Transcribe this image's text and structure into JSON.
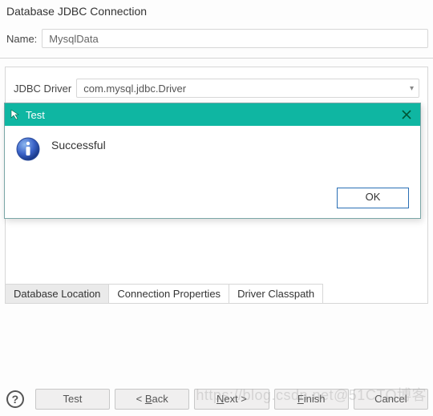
{
  "window_title": "Database JDBC Connection",
  "name_label": "Name:",
  "name_value": "MysqlData",
  "jdbc_driver_label": "JDBC Driver",
  "jdbc_driver_value": "com.mysql.jdbc.Driver",
  "jdbc_url_partial": "",
  "tabs": {
    "location": "Database Location",
    "conn_props": "Connection Properties",
    "classpath": "Driver Classpath"
  },
  "wizard": {
    "test": "Test",
    "back": "< Back",
    "next": "Next >",
    "finish": "Finish",
    "cancel": "Cancel"
  },
  "modal": {
    "title": "Test",
    "message": "Successful",
    "ok": "OK"
  },
  "watermark": "https://blog.csdn.net@51CTO博客"
}
